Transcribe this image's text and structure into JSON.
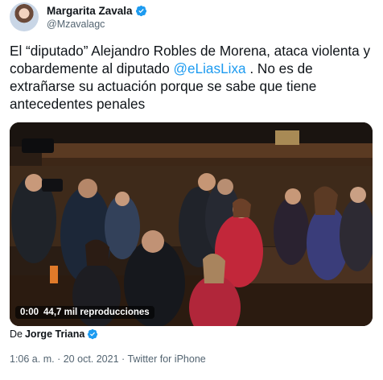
{
  "author": {
    "name": "Margarita Zavala",
    "handle": "@Mzavalagc",
    "verified": true
  },
  "tweet": {
    "text_part1": "El “diputado” Alejandro Robles de Morena, ataca violenta y cobardemente al diputado ",
    "mention": "@eLiasLixa",
    "text_part2": " . No es de extrañarse su actuación porque se sabe que tiene antecedentes penales"
  },
  "media": {
    "type": "video",
    "current_time": "0:00",
    "views": "44,7 mil reproducciones"
  },
  "credit": {
    "prefix": "De",
    "name": "Jorge Triana",
    "verified": true
  },
  "meta": {
    "time": "1:06 a. m.",
    "separator": "·",
    "date": "20 oct. 2021",
    "source": "Twitter for iPhone"
  },
  "colors": {
    "link": "#1d9bf0",
    "verified": "#1d9bf0",
    "secondary_text": "#536471"
  }
}
